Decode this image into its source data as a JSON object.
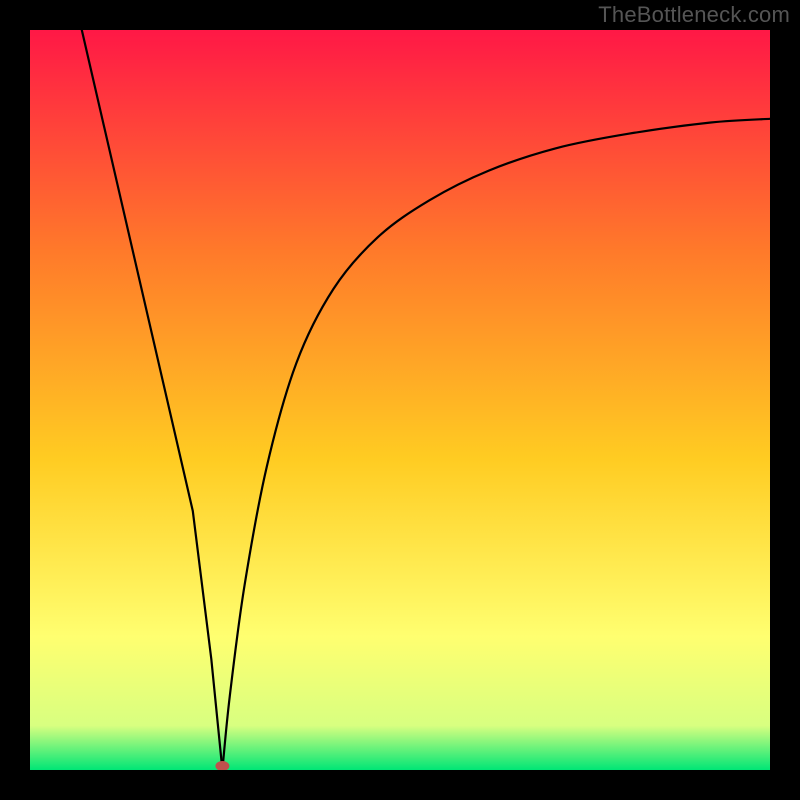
{
  "watermark": "TheBottleneck.com",
  "gradient_colors": {
    "top": "#ff1846",
    "upper_mid": "#ff7a2a",
    "mid": "#ffcc22",
    "lower_mid": "#ffff70",
    "near_bottom": "#d8ff80",
    "bottom": "#00e676"
  },
  "chart_data": {
    "type": "line",
    "title": "",
    "xlabel": "",
    "ylabel": "",
    "xlim": [
      0,
      100
    ],
    "ylim": [
      0,
      100
    ],
    "series": [
      {
        "name": "left-branch",
        "x": [
          7,
          10,
          13,
          16,
          19,
          22,
          24.5,
          25.5,
          26
        ],
        "values": [
          100,
          87,
          74,
          61,
          48,
          35,
          15,
          5,
          0
        ]
      },
      {
        "name": "right-branch",
        "x": [
          26,
          27,
          29,
          32,
          36,
          41,
          47,
          54,
          62,
          71,
          81,
          92,
          100
        ],
        "values": [
          0,
          10,
          25,
          41,
          55,
          65,
          72,
          77,
          81,
          84,
          86,
          87.5,
          88
        ]
      }
    ],
    "marker": {
      "x": 26,
      "y": 0,
      "color": "#c0504d"
    },
    "green_band_y": [
      0,
      4
    ]
  }
}
